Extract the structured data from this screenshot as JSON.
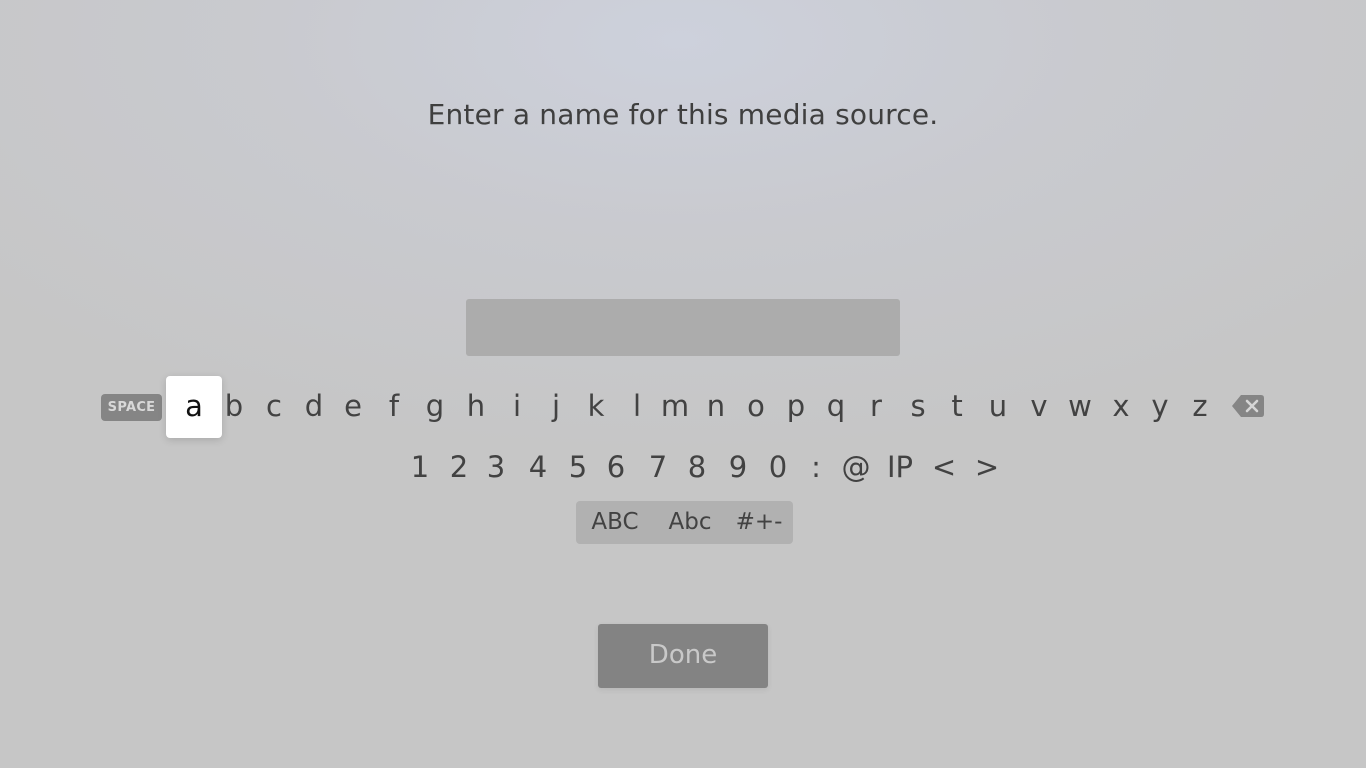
{
  "prompt": {
    "text": "Enter a name for this media source."
  },
  "text_field": {
    "value": ""
  },
  "keyboard": {
    "space_label": "SPACE",
    "letters": [
      "a",
      "b",
      "c",
      "d",
      "e",
      "f",
      "g",
      "h",
      "i",
      "j",
      "k",
      "l",
      "m",
      "n",
      "o",
      "p",
      "q",
      "r",
      "s",
      "t",
      "u",
      "v",
      "w",
      "x",
      "y",
      "z"
    ],
    "focused_key": "a",
    "backspace_icon": "backspace-icon",
    "numbers_symbols": [
      "1",
      "2",
      "3",
      "4",
      "5",
      "6",
      "7",
      "8",
      "9",
      "0",
      ":",
      "@",
      "IP",
      "<",
      ">"
    ],
    "modes": [
      "ABC",
      "Abc",
      "#+-"
    ]
  },
  "done_button": {
    "label": "Done"
  },
  "colors": {
    "focused_key_bg": "#ffffff",
    "done_bg": "#838383",
    "field_bg": "#acacac"
  }
}
